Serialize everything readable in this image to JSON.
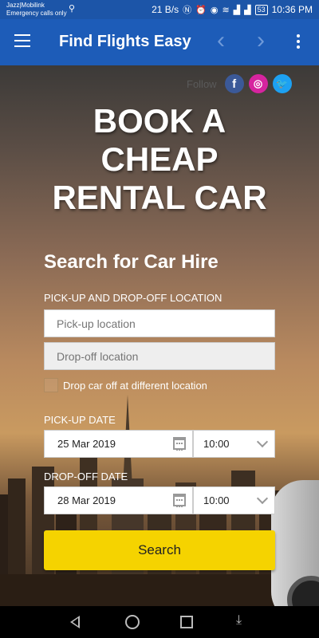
{
  "status_bar": {
    "carrier_line1": "Jazz|Mobilink",
    "carrier_line2": "Emergency calls only",
    "usb_icon": "usb-icon",
    "data_rate": "21 B/s",
    "battery": "53",
    "time": "10:36 PM"
  },
  "app_bar": {
    "title": "Find Flights Easy",
    "menu_icon": "hamburger-menu-icon",
    "prev_icon": "chevron-left-icon",
    "next_icon": "chevron-right-icon",
    "more_icon": "more-vert-icon"
  },
  "social": {
    "follow_label": "Follow",
    "facebook": "f",
    "instagram": "◎",
    "twitter": "🐦"
  },
  "hero": {
    "line1": "BOOK A",
    "line2": "CHEAP",
    "line3": "RENTAL CAR"
  },
  "form": {
    "title": "Search for Car Hire",
    "location_label": "PICK-UP AND DROP-OFF LOCATION",
    "pickup_placeholder": "Pick-up location",
    "dropoff_placeholder": "Drop-off location",
    "different_location_label": "Drop car off at different location",
    "pickup_date_label": "PICK-UP DATE",
    "pickup_date": "25 Mar 2019",
    "pickup_time": "10:00",
    "dropoff_date_label": "DROP-OFF DATE",
    "dropoff_date": "28 Mar 2019",
    "dropoff_time": "10:00",
    "search_label": "Search"
  },
  "colors": {
    "app_bar": "#1d5cb8",
    "search_button": "#f5d300"
  }
}
